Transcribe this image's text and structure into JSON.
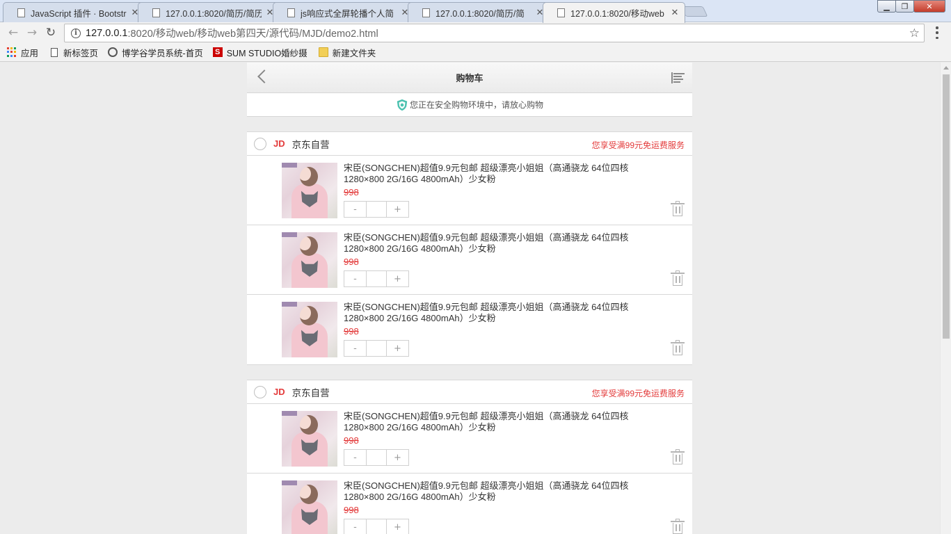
{
  "browser": {
    "tabs": [
      {
        "title": "JavaScript 插件 · Bootstrap",
        "active": false
      },
      {
        "title": "127.0.0.1:8020/简历/简历",
        "active": false
      },
      {
        "title": "js响应式全屏轮播个人简",
        "active": false
      },
      {
        "title": "127.0.0.1:8020/简历/简",
        "active": false
      },
      {
        "title": "127.0.0.1:8020/移动web",
        "active": true
      }
    ],
    "window_buttons": {
      "minimize": "▁",
      "maximize": "❐",
      "close": "✕"
    },
    "url_host": "127.0.0.1",
    "url_rest": ":8020/移动web/移动web第四天/源代码/MJD/demo2.html",
    "bookmarks": [
      {
        "label": "应用",
        "icon": "apps-icon"
      },
      {
        "label": "新标签页",
        "icon": "page-icon"
      },
      {
        "label": "博学谷学员系统-首页",
        "icon": "site-icon"
      },
      {
        "label": "SUM STUDIO婚纱摄",
        "icon": "s-brand-icon",
        "icon_text": "S"
      },
      {
        "label": "新建文件夹",
        "icon": "folder-icon"
      }
    ]
  },
  "page": {
    "header": {
      "title": "购物车"
    },
    "notice": "您正在安全购物环境中，请放心购物",
    "colors": {
      "accent": "#e33a3a",
      "border": "#d8d8d8"
    },
    "shops": [
      {
        "logo": "JD",
        "name": "京东自营",
        "shipping_note": "您享受满99元免运费服务",
        "items": [
          {
            "title": "宋臣(SONGCHEN)超值9.9元包邮 超级漂亮小姐姐（高通骁龙 64位四核 1280×800 2G/16G 4800mAh）少女粉",
            "price": "998",
            "minus": "-",
            "plus": "+",
            "qty": ""
          },
          {
            "title": "宋臣(SONGCHEN)超值9.9元包邮 超级漂亮小姐姐（高通骁龙 64位四核 1280×800 2G/16G 4800mAh）少女粉",
            "price": "998",
            "minus": "-",
            "plus": "+",
            "qty": ""
          },
          {
            "title": "宋臣(SONGCHEN)超值9.9元包邮 超级漂亮小姐姐（高通骁龙 64位四核 1280×800 2G/16G 4800mAh）少女粉",
            "price": "998",
            "minus": "-",
            "plus": "+",
            "qty": ""
          }
        ]
      },
      {
        "logo": "JD",
        "name": "京东自营",
        "shipping_note": "您享受满99元免运费服务",
        "items": [
          {
            "title": "宋臣(SONGCHEN)超值9.9元包邮 超级漂亮小姐姐（高通骁龙 64位四核 1280×800 2G/16G 4800mAh）少女粉",
            "price": "998",
            "minus": "-",
            "plus": "+",
            "qty": ""
          },
          {
            "title": "宋臣(SONGCHEN)超值9.9元包邮 超级漂亮小姐姐（高通骁龙 64位四核 1280×800 2G/16G 4800mAh）少女粉",
            "price": "998",
            "minus": "-",
            "plus": "+",
            "qty": ""
          }
        ]
      }
    ]
  }
}
